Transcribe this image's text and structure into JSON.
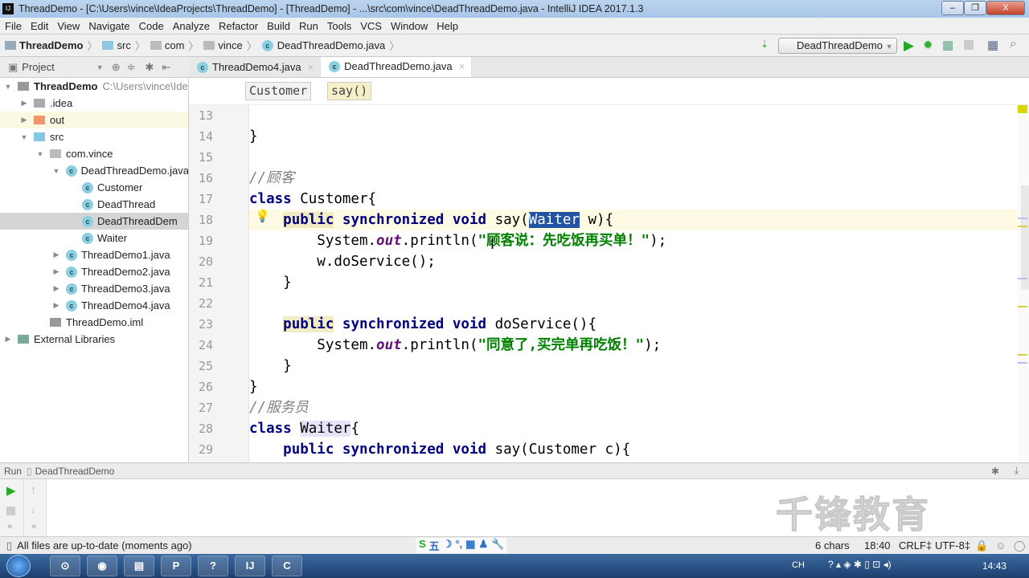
{
  "window": {
    "title": "ThreadDemo - [C:\\Users\\vince\\IdeaProjects\\ThreadDemo] - [ThreadDemo] - ...\\src\\com\\vince\\DeadThreadDemo.java - IntelliJ IDEA 2017.1.3",
    "minimize": "–",
    "restore": "❐",
    "close": "X"
  },
  "menu": [
    "File",
    "Edit",
    "View",
    "Navigate",
    "Code",
    "Analyze",
    "Refactor",
    "Build",
    "Run",
    "Tools",
    "VCS",
    "Window",
    "Help"
  ],
  "breadcrumb": [
    "ThreadDemo",
    "src",
    "com",
    "vince",
    "DeadThreadDemo.java"
  ],
  "toolbar": {
    "run_config": "DeadThreadDemo"
  },
  "project_panel": {
    "title": "Project"
  },
  "tabs": [
    {
      "label": "ThreadDemo4.java",
      "active": false
    },
    {
      "label": "DeadThreadDemo.java",
      "active": true
    }
  ],
  "tree": [
    {
      "label": "ThreadDemo",
      "hint": "C:\\Users\\vince\\Ide",
      "depth": 0,
      "arrow": "▼",
      "icon": "module",
      "bold": true
    },
    {
      "label": ".idea",
      "depth": 1,
      "arrow": "▶",
      "icon": "folder-gray"
    },
    {
      "label": "out",
      "depth": 1,
      "arrow": "▶",
      "icon": "folder-orange",
      "highlight": true
    },
    {
      "label": "src",
      "depth": 1,
      "arrow": "▼",
      "icon": "folder-blue"
    },
    {
      "label": "com.vince",
      "depth": 2,
      "arrow": "▼",
      "icon": "package"
    },
    {
      "label": "DeadThreadDemo.java",
      "depth": 3,
      "arrow": "▼",
      "icon": "class"
    },
    {
      "label": "Customer",
      "depth": 4,
      "arrow": "",
      "icon": "class"
    },
    {
      "label": "DeadThread",
      "depth": 4,
      "arrow": "",
      "icon": "class"
    },
    {
      "label": "DeadThreadDem",
      "depth": 4,
      "arrow": "",
      "icon": "class",
      "selected": true
    },
    {
      "label": "Waiter",
      "depth": 4,
      "arrow": "",
      "icon": "class"
    },
    {
      "label": "ThreadDemo1.java",
      "depth": 3,
      "arrow": "▶",
      "icon": "class"
    },
    {
      "label": "ThreadDemo2.java",
      "depth": 3,
      "arrow": "▶",
      "icon": "class"
    },
    {
      "label": "ThreadDemo3.java",
      "depth": 3,
      "arrow": "▶",
      "icon": "class"
    },
    {
      "label": "ThreadDemo4.java",
      "depth": 3,
      "arrow": "▶",
      "icon": "class"
    },
    {
      "label": "ThreadDemo.iml",
      "depth": 2,
      "arrow": "",
      "icon": "file"
    },
    {
      "label": "External Libraries",
      "depth": 0,
      "arrow": "▶",
      "icon": "library"
    }
  ],
  "editor_breadcrumb": [
    "Customer",
    "say()"
  ],
  "code": [
    {
      "n": "13",
      "t": []
    },
    {
      "n": "14",
      "t": [
        [
          "}",
          ""
        ]
      ]
    },
    {
      "n": "15",
      "t": []
    },
    {
      "n": "16",
      "t": [
        [
          "//顾客",
          "cm"
        ]
      ]
    },
    {
      "n": "17",
      "t": [
        [
          "class ",
          "kw"
        ],
        [
          "Customer{",
          ""
        ]
      ]
    },
    {
      "n": "18",
      "cur": true,
      "t": [
        [
          "    ",
          ""
        ],
        [
          "public",
          "kwh"
        ],
        [
          " synchronized void ",
          "kw"
        ],
        [
          "say(",
          ""
        ],
        [
          "Waiter",
          "sel"
        ],
        [
          " w){",
          ""
        ]
      ]
    },
    {
      "n": "19",
      "t": [
        [
          "        System.",
          ""
        ],
        [
          "out",
          "fl"
        ],
        [
          ".println(",
          ""
        ],
        [
          "\"顾客说：先吃饭再买单！\"",
          "st"
        ],
        [
          ");",
          ""
        ]
      ]
    },
    {
      "n": "20",
      "t": [
        [
          "        w.doService();",
          ""
        ]
      ]
    },
    {
      "n": "21",
      "t": [
        [
          "    }",
          ""
        ]
      ]
    },
    {
      "n": "22",
      "t": []
    },
    {
      "n": "23",
      "t": [
        [
          "    ",
          ""
        ],
        [
          "public",
          "kwh"
        ],
        [
          " synchronized void ",
          "kw"
        ],
        [
          "doService(){",
          ""
        ]
      ]
    },
    {
      "n": "24",
      "t": [
        [
          "        System.",
          ""
        ],
        [
          "out",
          "fl"
        ],
        [
          ".println(",
          ""
        ],
        [
          "\"同意了,买完单再吃饭！\"",
          "st"
        ],
        [
          ");",
          ""
        ]
      ]
    },
    {
      "n": "25",
      "t": [
        [
          "    }",
          ""
        ]
      ]
    },
    {
      "n": "26",
      "t": [
        [
          "}",
          ""
        ]
      ]
    },
    {
      "n": "27",
      "t": [
        [
          "//服务员",
          "cm"
        ]
      ]
    },
    {
      "n": "28",
      "t": [
        [
          "class ",
          "kw"
        ],
        [
          "Waiter",
          "hl"
        ],
        [
          "{",
          ""
        ]
      ]
    },
    {
      "n": "29",
      "t": [
        [
          "    ",
          ""
        ],
        [
          "public synchronized void ",
          "kw"
        ],
        [
          "say(Customer c){",
          ""
        ]
      ]
    }
  ],
  "run_panel": {
    "label": "Run",
    "config": "DeadThreadDemo"
  },
  "status": {
    "message": "All files are up-to-date (moments ago)",
    "chars": "6 chars",
    "position": "18:40",
    "line_sep": "CRLF‡",
    "encoding": "UTF-8‡"
  },
  "ime": [
    "S",
    "五",
    "☽",
    "°,",
    "▦",
    "♟",
    "🔧"
  ],
  "watermark": "千锋教育",
  "taskbar": {
    "apps": [
      "⊙",
      "◉",
      "▤",
      "P",
      "?",
      "IJ",
      "C"
    ],
    "tray_lang": "CH",
    "clock": "14:43"
  }
}
